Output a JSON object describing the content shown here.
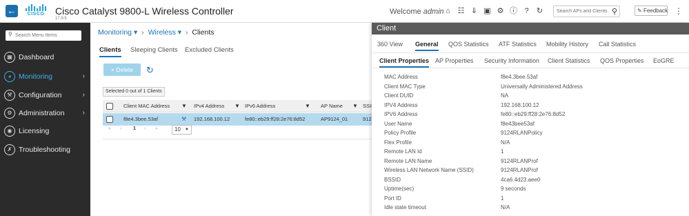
{
  "header": {
    "brand": "CISCO",
    "title": "Cisco Catalyst 9800-L Wireless Controller",
    "version": "17.9.5",
    "welcome_prefix": "Welcome",
    "welcome_user": "admin",
    "search_placeholder": "Search APs and Clients",
    "feedback_label": "Feedback",
    "icons": [
      "home-icon",
      "wireless-icon",
      "download-icon",
      "save-icon",
      "gear-icon",
      "info-icon",
      "help-icon",
      "refresh-icon"
    ]
  },
  "sidebar": {
    "search_placeholder": "Search Menu Items",
    "items": [
      {
        "label": "Dashboard",
        "icon": "dashboard-icon",
        "chevron": ""
      },
      {
        "label": "Monitoring",
        "icon": "monitoring-icon",
        "chevron": "›",
        "active": true
      },
      {
        "label": "Configuration",
        "icon": "wrench-icon",
        "chevron": "›"
      },
      {
        "label": "Administration",
        "icon": "gear-icon",
        "chevron": "›"
      },
      {
        "label": "Licensing",
        "icon": "licensing-icon",
        "chevron": ""
      },
      {
        "label": "Troubleshooting",
        "icon": "tools-icon",
        "chevron": ""
      }
    ]
  },
  "breadcrumb": {
    "monitoring": "Monitoring",
    "wireless": "Wireless",
    "clients": "Clients",
    "sep": "›",
    "caret": "▾"
  },
  "subtabs": [
    "Clients",
    "Sleeping Clients",
    "Excluded Clients"
  ],
  "toolbar": {
    "delete_label": "Delete",
    "delete_icon": "×",
    "selected_text": "Selected 0 out of 1 Clients"
  },
  "grid": {
    "columns": [
      "Client MAC Address",
      "IPv4 Address",
      "IPv6 Address",
      "AP Name",
      "SSID"
    ],
    "rows": [
      {
        "mac": "f8e4.3bee.53af",
        "ipv4": "192.168.100.12",
        "ipv6": "fe80::eb29:ff28:2e76:8d52",
        "ap": "AP9124_01",
        "ssid": "912"
      }
    ],
    "pager": {
      "first": "«",
      "prev": "‹",
      "page": "1",
      "next": "›",
      "last": "»",
      "page_size": "10"
    }
  },
  "panel": {
    "title": "Client",
    "tabs": [
      "360 View",
      "General",
      "QOS Statistics",
      "ATF Statistics",
      "Mobility History",
      "Call Statistics"
    ],
    "subtabs": [
      "Client Properties",
      "AP Properties",
      "Security Information",
      "Client Statistics",
      "QOS Properties",
      "EoGRE"
    ],
    "properties": [
      {
        "key": "MAC Address",
        "value": "f8e4.3bee.53af"
      },
      {
        "key": "Client MAC Type",
        "value": "Universally Administered Address"
      },
      {
        "key": "Client DUID",
        "value": "NA"
      },
      {
        "key": "IPV4 Address",
        "value": "192.168.100.12"
      },
      {
        "key": "IPV6 Address",
        "value": "fe80::eb29:ff28:2e76:8d52"
      },
      {
        "key": "User Name",
        "value": "f8e43bee53af"
      },
      {
        "key": "Policy Profile",
        "value": "9124RLANPolicy"
      },
      {
        "key": "Flex Profile",
        "value": "N/A"
      },
      {
        "key": "Remote LAN Id",
        "value": "1"
      },
      {
        "key": "Remote LAN Name",
        "value": "9124RLANProf"
      },
      {
        "key": "Wireless LAN Network Name (SSID)",
        "value": "9124RLANProf"
      },
      {
        "key": "BSSID",
        "value": "4ca6.4d23.aee0"
      },
      {
        "key": "Uptime(sec)",
        "value": "9 seconds"
      },
      {
        "key": "Port ID",
        "value": "1"
      },
      {
        "key": "Idle state timeout",
        "value": "N/A"
      }
    ]
  }
}
